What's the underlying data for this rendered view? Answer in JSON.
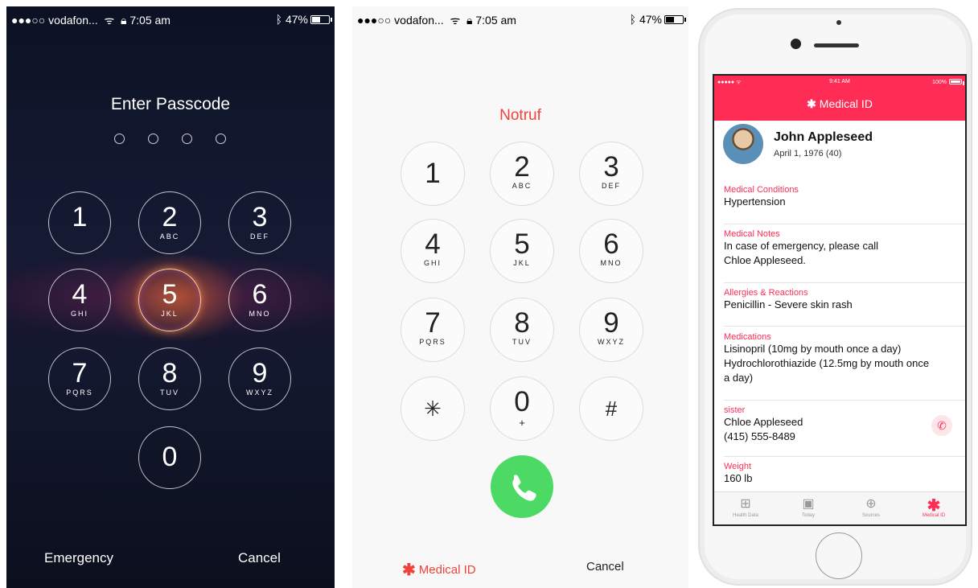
{
  "lock": {
    "status": {
      "carrier": "●●●○○ vodafon...",
      "time": "7:05 am",
      "battery": "47%"
    },
    "title": "Enter Passcode",
    "keys": [
      {
        "num": "1",
        "letters": ""
      },
      {
        "num": "2",
        "letters": "ABC"
      },
      {
        "num": "3",
        "letters": "DEF"
      },
      {
        "num": "4",
        "letters": "GHI"
      },
      {
        "num": "5",
        "letters": "JKL"
      },
      {
        "num": "6",
        "letters": "MNO"
      },
      {
        "num": "7",
        "letters": "PQRS"
      },
      {
        "num": "8",
        "letters": "TUV"
      },
      {
        "num": "9",
        "letters": "WXYZ"
      },
      {
        "num": "0",
        "letters": ""
      }
    ],
    "emergency_label": "Emergency",
    "cancel_label": "Cancel"
  },
  "dialer": {
    "status": {
      "carrier": "●●●○○ vodafon...",
      "time": "7:05 am",
      "battery": "47%"
    },
    "title": "Notruf",
    "keys": [
      {
        "num": "1",
        "letters": ""
      },
      {
        "num": "2",
        "letters": "ABC"
      },
      {
        "num": "3",
        "letters": "DEF"
      },
      {
        "num": "4",
        "letters": "GHI"
      },
      {
        "num": "5",
        "letters": "JKL"
      },
      {
        "num": "6",
        "letters": "MNO"
      },
      {
        "num": "7",
        "letters": "PQRS"
      },
      {
        "num": "8",
        "letters": "TUV"
      },
      {
        "num": "9",
        "letters": "WXYZ"
      },
      {
        "num": "✳",
        "letters": ""
      },
      {
        "num": "0",
        "letters": "+"
      },
      {
        "num": "#",
        "letters": ""
      }
    ],
    "medical_id_label": "Medical ID",
    "cancel_label": "Cancel",
    "accent": "#f0413a",
    "call_color": "#4cd964"
  },
  "medical": {
    "status": {
      "carrier": "●●●●● ᯤ",
      "time": "9:41 AM",
      "battery": "100%"
    },
    "title": "Medical ID",
    "name": "John Appleseed",
    "dob": "April 1, 1976 (40)",
    "conditions_label": "Medical Conditions",
    "conditions": "Hypertension",
    "notes_label": "Medical Notes",
    "notes_1": "In case of emergency, please call",
    "notes_2": "Chloe Appleseed.",
    "allergies_label": "Allergies & Reactions",
    "allergies": "Penicillin - Severe skin rash",
    "medications_label": "Medications",
    "med_1": "Lisinopril (10mg by mouth once a day)",
    "med_2": "Hydrochlorothiazide (12.5mg by mouth once",
    "med_3": "a day)",
    "contact_label": "sister",
    "contact_name": "Chloe Appleseed",
    "contact_phone": "(415) 555-8489",
    "weight_label": "Weight",
    "weight": "160 lb",
    "tabs": [
      {
        "label": "Health Data",
        "icon": "grid-icon"
      },
      {
        "label": "Today",
        "icon": "calendar-icon"
      },
      {
        "label": "Sources",
        "icon": "download-icon"
      },
      {
        "label": "Medical ID",
        "icon": "asterisk-icon"
      }
    ],
    "accent": "#ff2d55"
  }
}
